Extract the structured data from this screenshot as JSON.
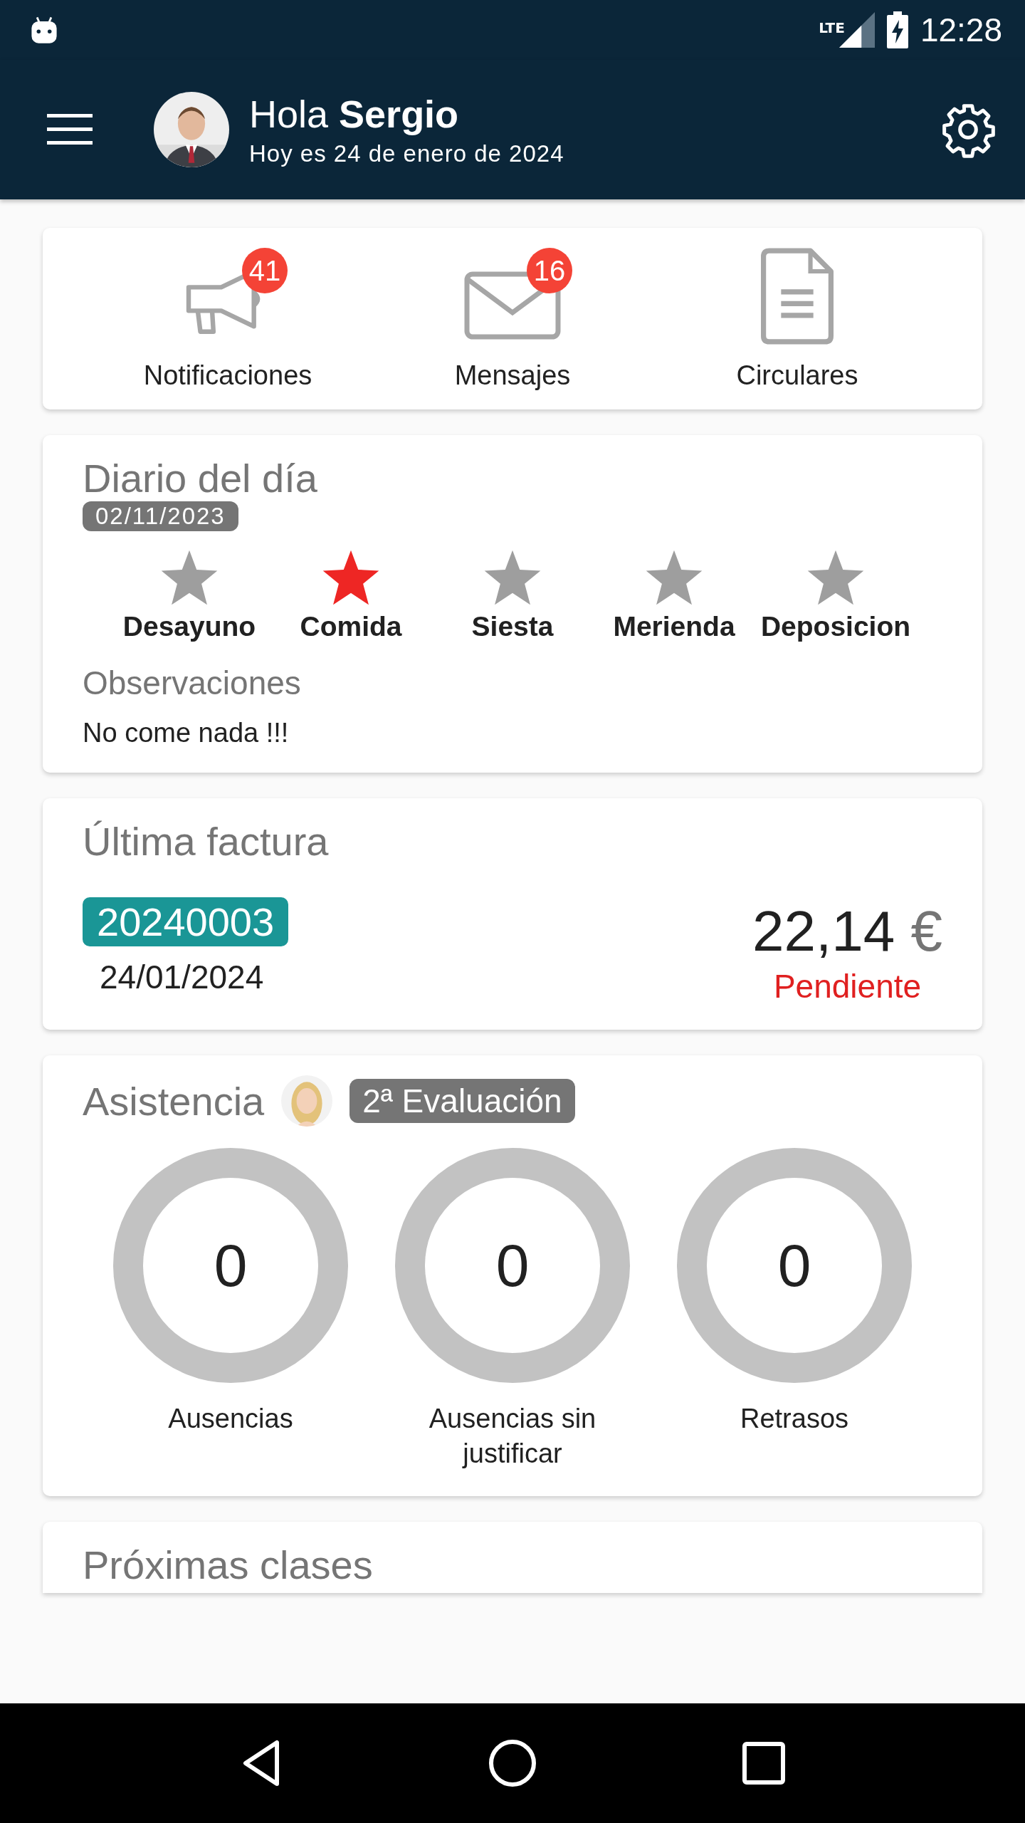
{
  "status_bar": {
    "network": "LTE",
    "time": "12:28"
  },
  "header": {
    "greeting": "Hola **Sergio**",
    "date": "Hoy es 24 de enero de 2024"
  },
  "shortcuts": [
    {
      "kind": "megaphone",
      "label": "Notificaciones",
      "badge": "41"
    },
    {
      "kind": "mail",
      "label": "Mensajes",
      "badge": "16"
    },
    {
      "kind": "document",
      "label": "Circulares"
    }
  ],
  "diary": {
    "title": "Diario del día",
    "date": "02/11/2023",
    "items": [
      {
        "label": "Desayuno",
        "selected": false
      },
      {
        "label": "Comida",
        "selected": true
      },
      {
        "label": "Siesta",
        "selected": false
      },
      {
        "label": "Merienda",
        "selected": false
      },
      {
        "label": "Deposicion",
        "selected": false
      }
    ],
    "observations_label": "Observaciones",
    "observations": "No come nada !!!"
  },
  "invoice": {
    "title": "Última factura",
    "number": "20240003",
    "date": "24/01/2024",
    "amount": "22,14",
    "currency": "€",
    "status": "Pendiente"
  },
  "attendance": {
    "title": "Asistencia",
    "period": "2ª Evaluación",
    "stats": [
      {
        "value": "0",
        "label": "Ausencias"
      },
      {
        "value": "0",
        "label": "Ausencias sin justificar"
      },
      {
        "value": "0",
        "label": "Retrasos"
      }
    ]
  },
  "next_card": {
    "title": "Próximas clases"
  }
}
